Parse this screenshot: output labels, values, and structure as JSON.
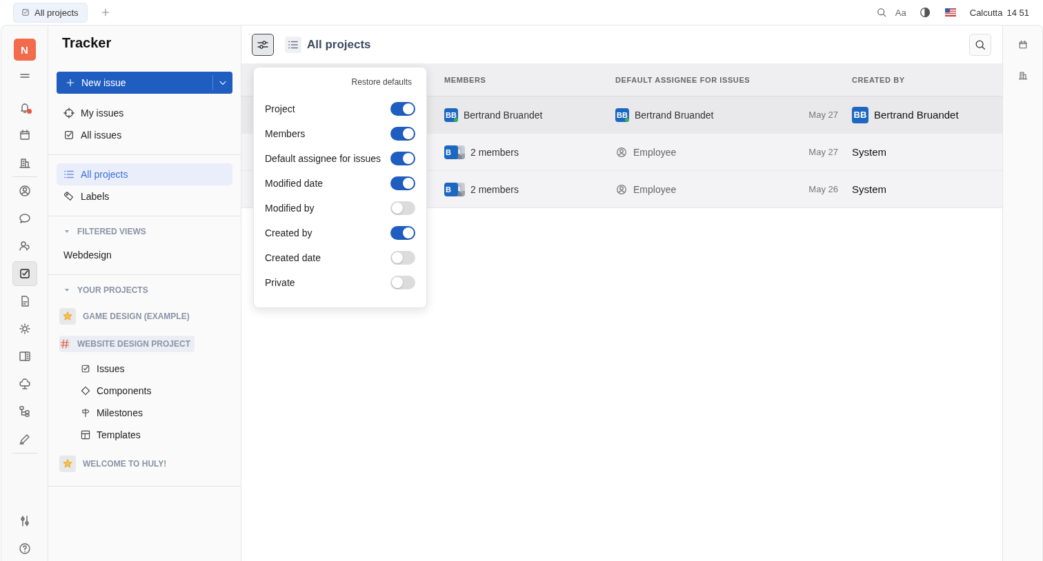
{
  "top_bar": {
    "tabs": [
      {
        "label": "All projects",
        "selected": true
      }
    ],
    "font_button": "Aa",
    "city": "Calcutta",
    "time": "14 51"
  },
  "rail": {
    "logo": "N",
    "groups": [
      [
        {
          "selected": false,
          "badge": false
        }
      ],
      [
        {
          "selected": false,
          "badge": true
        },
        {
          "selected": false,
          "badge": false
        },
        {
          "selected": false,
          "badge": false
        }
      ],
      [
        {
          "selected": false,
          "badge": false
        },
        {
          "selected": false,
          "badge": false
        },
        {
          "selected": false,
          "badge": false
        },
        {
          "selected": true,
          "badge": false
        },
        {
          "selected": false,
          "badge": false
        },
        {
          "selected": false,
          "badge": false
        },
        {
          "selected": false,
          "badge": false
        },
        {
          "selected": false,
          "badge": false
        },
        {
          "selected": false,
          "badge": false
        },
        {
          "selected": false,
          "badge": false
        }
      ],
      [
        {
          "selected": false,
          "badge": false
        },
        {
          "selected": false,
          "badge": false
        }
      ]
    ]
  },
  "sidebar": {
    "title": "Tracker",
    "new_issue": "New issue",
    "nav_groups": [
      [
        {
          "label": "My issues",
          "selected": false
        },
        {
          "label": "All issues",
          "selected": false
        }
      ],
      [
        {
          "label": "All projects",
          "selected": true
        },
        {
          "label": "Labels",
          "selected": false
        }
      ]
    ],
    "filtered_views": {
      "title": "FILTERED VIEWS",
      "expanded": true,
      "items": [
        {
          "label": "Webdesign",
          "selected": false
        }
      ]
    },
    "your_projects": {
      "title": "YOUR PROJECTS",
      "expanded": true,
      "items": [
        {
          "label": "GAME DESIGN (EXAMPLE)",
          "kind": "emoji",
          "selected": false
        },
        {
          "label": "WEBSITE DESIGN PROJECT",
          "kind": "hash",
          "selected": true,
          "children": [
            {
              "label": "Issues",
              "selected": false
            },
            {
              "label": "Components",
              "selected": false
            },
            {
              "label": "Milestones",
              "selected": false
            },
            {
              "label": "Templates",
              "selected": false
            }
          ]
        },
        {
          "label": "WELCOME TO HULY!",
          "kind": "emoji",
          "selected": false
        }
      ]
    }
  },
  "content": {
    "title": "All projects",
    "view_settings_open": true,
    "table": {
      "header": {
        "members": "MEMBERS",
        "default_assignee": "DEFAULT ASSIGNEE FOR ISSUES",
        "created_by": "CREATED BY"
      },
      "rows": [
        {
          "selected": true,
          "members": {
            "kind": "person",
            "initials": "BB",
            "name": "Bertrand Bruandet",
            "online": true
          },
          "default_assignee": {
            "kind": "person",
            "initials": "BB",
            "name": "Bertrand Bruandet",
            "online": true
          },
          "modified_date": "May 27",
          "created_by": {
            "kind": "person",
            "initials": "BB",
            "name": "Bertrand Bruandet",
            "online": false
          }
        },
        {
          "selected": false,
          "members": {
            "kind": "group",
            "initials": "B",
            "name": "2 members"
          },
          "default_assignee": {
            "kind": "role",
            "name": "Employee"
          },
          "modified_date": "May 27",
          "created_by": {
            "kind": "system",
            "name": "System"
          }
        },
        {
          "selected": false,
          "members": {
            "kind": "group",
            "initials": "B",
            "name": "2 members"
          },
          "default_assignee": {
            "kind": "role",
            "name": "Employee"
          },
          "modified_date": "May 26",
          "created_by": {
            "kind": "system",
            "name": "System"
          }
        }
      ]
    },
    "column_menu": {
      "restore": "Restore defaults",
      "options": [
        {
          "label": "Project",
          "on": true
        },
        {
          "label": "Members",
          "on": true
        },
        {
          "label": "Default assignee for issues",
          "on": true
        },
        {
          "label": "Modified date",
          "on": true
        },
        {
          "label": "Modified by",
          "on": false
        },
        {
          "label": "Created by",
          "on": true
        },
        {
          "label": "Created date",
          "on": false
        },
        {
          "label": "Private",
          "on": false
        }
      ]
    }
  }
}
